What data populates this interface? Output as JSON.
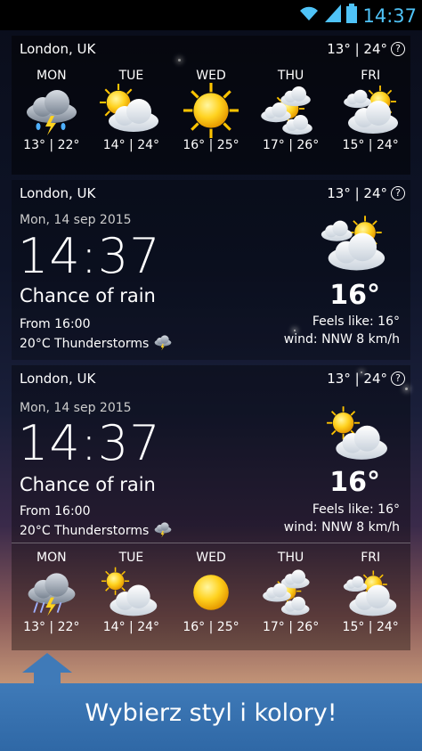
{
  "status": {
    "time": "14:37"
  },
  "widget1": {
    "location": "London, UK",
    "minmax": "13° | 24°",
    "forecast": [
      {
        "day": "MON",
        "icon": "thunderstorm-icon",
        "temps": "13° | 22°"
      },
      {
        "day": "TUE",
        "icon": "partly-cloudy-icon",
        "temps": "14° | 24°"
      },
      {
        "day": "WED",
        "icon": "sun-icon",
        "temps": "16° | 25°"
      },
      {
        "day": "THU",
        "icon": "sun-clouds-icon",
        "temps": "17° | 26°"
      },
      {
        "day": "FRI",
        "icon": "partly-cloudy-icon",
        "temps": "15° | 24°"
      }
    ]
  },
  "widget2": {
    "location": "London, UK",
    "minmax": "13° | 24°",
    "date": "Mon, 14 sep 2015",
    "time": "14:37",
    "condition": "Chance of rain",
    "from": "From 16:00",
    "storm": "20°C Thunderstorms",
    "temp": "16°",
    "feels": "Feels like: 16°",
    "wind": "wind: NNW 8 km/h"
  },
  "widget3": {
    "location": "London, UK",
    "minmax": "13° | 24°",
    "date": "Mon, 14 sep 2015",
    "time": "14:37",
    "condition": "Chance of rain",
    "from": "From 16:00",
    "storm": "20°C Thunderstorms",
    "temp": "16°",
    "feels": "Feels like: 16°",
    "wind": "wind: NNW 8 km/h",
    "forecast": [
      {
        "day": "MON",
        "icon": "thunderstorm-icon",
        "temps": "13° | 22°"
      },
      {
        "day": "TUE",
        "icon": "partly-cloudy-icon",
        "temps": "14° | 24°"
      },
      {
        "day": "WED",
        "icon": "sun-icon",
        "temps": "16° | 25°"
      },
      {
        "day": "THU",
        "icon": "sun-clouds-icon",
        "temps": "17° | 26°"
      },
      {
        "day": "FRI",
        "icon": "partly-cloudy-icon",
        "temps": "15° | 24°"
      }
    ]
  },
  "banner": {
    "text": "Wybierz styl i kolory!"
  },
  "colors": {
    "accent": "#4fc3f7",
    "banner": "#3f7ab8"
  }
}
